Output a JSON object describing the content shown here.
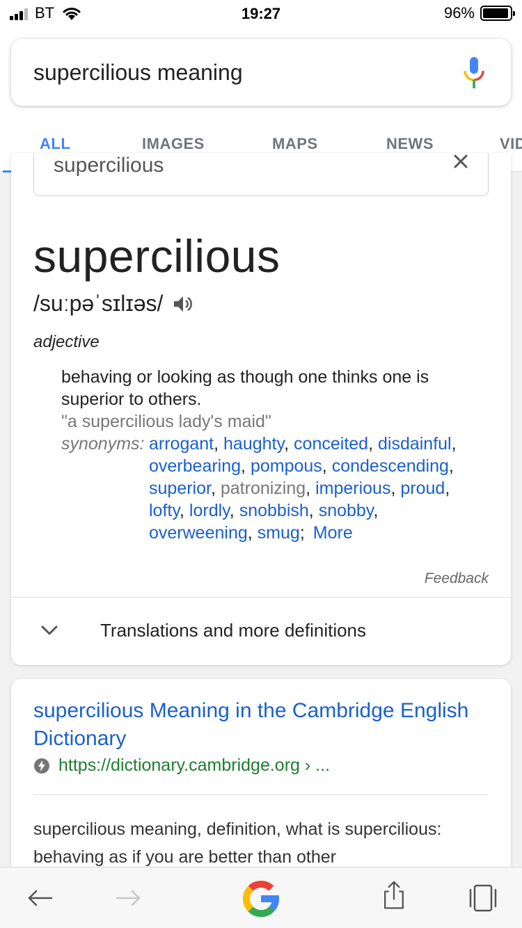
{
  "status_bar": {
    "carrier": "BT",
    "time": "19:27",
    "battery": "96%",
    "battery_level": 0.96
  },
  "search": {
    "query": "supercilious meaning"
  },
  "tabs": [
    {
      "label": "ALL",
      "active": true
    },
    {
      "label": "IMAGES"
    },
    {
      "label": "MAPS"
    },
    {
      "label": "NEWS"
    },
    {
      "label": "VID"
    }
  ],
  "dictionary": {
    "search_value": "supercilious",
    "word": "supercilious",
    "phonetic": "/suːpəˈsɪlɪəs/",
    "part_of_speech": "adjective",
    "definition": "behaving or looking as though one thinks one is superior to others.",
    "example": "\"a supercilious lady's maid\"",
    "synonyms_label": "synonyms:",
    "synonyms": [
      "arrogant",
      "haughty",
      "conceited",
      "disdainful",
      "overbearing",
      "pompous",
      "condescending",
      "superior",
      "patronizing",
      "imperious",
      "proud",
      "lofty",
      "lordly",
      "snobbish",
      "snobby",
      "overweening",
      "smug"
    ],
    "more_label": "More",
    "feedback": "Feedback",
    "expand_label": "Translations and more definitions"
  },
  "result": {
    "title": "supercilious Meaning in the Cambridge English Dictionary",
    "url": "https://dictionary.cambridge.org › ...",
    "snippet": "supercilious meaning, definition, what is supercilious: behaving as if you are better than other"
  },
  "colors": {
    "accent": "#4285f4",
    "link": "#1a5fd0",
    "url_green": "#1e7d32"
  }
}
